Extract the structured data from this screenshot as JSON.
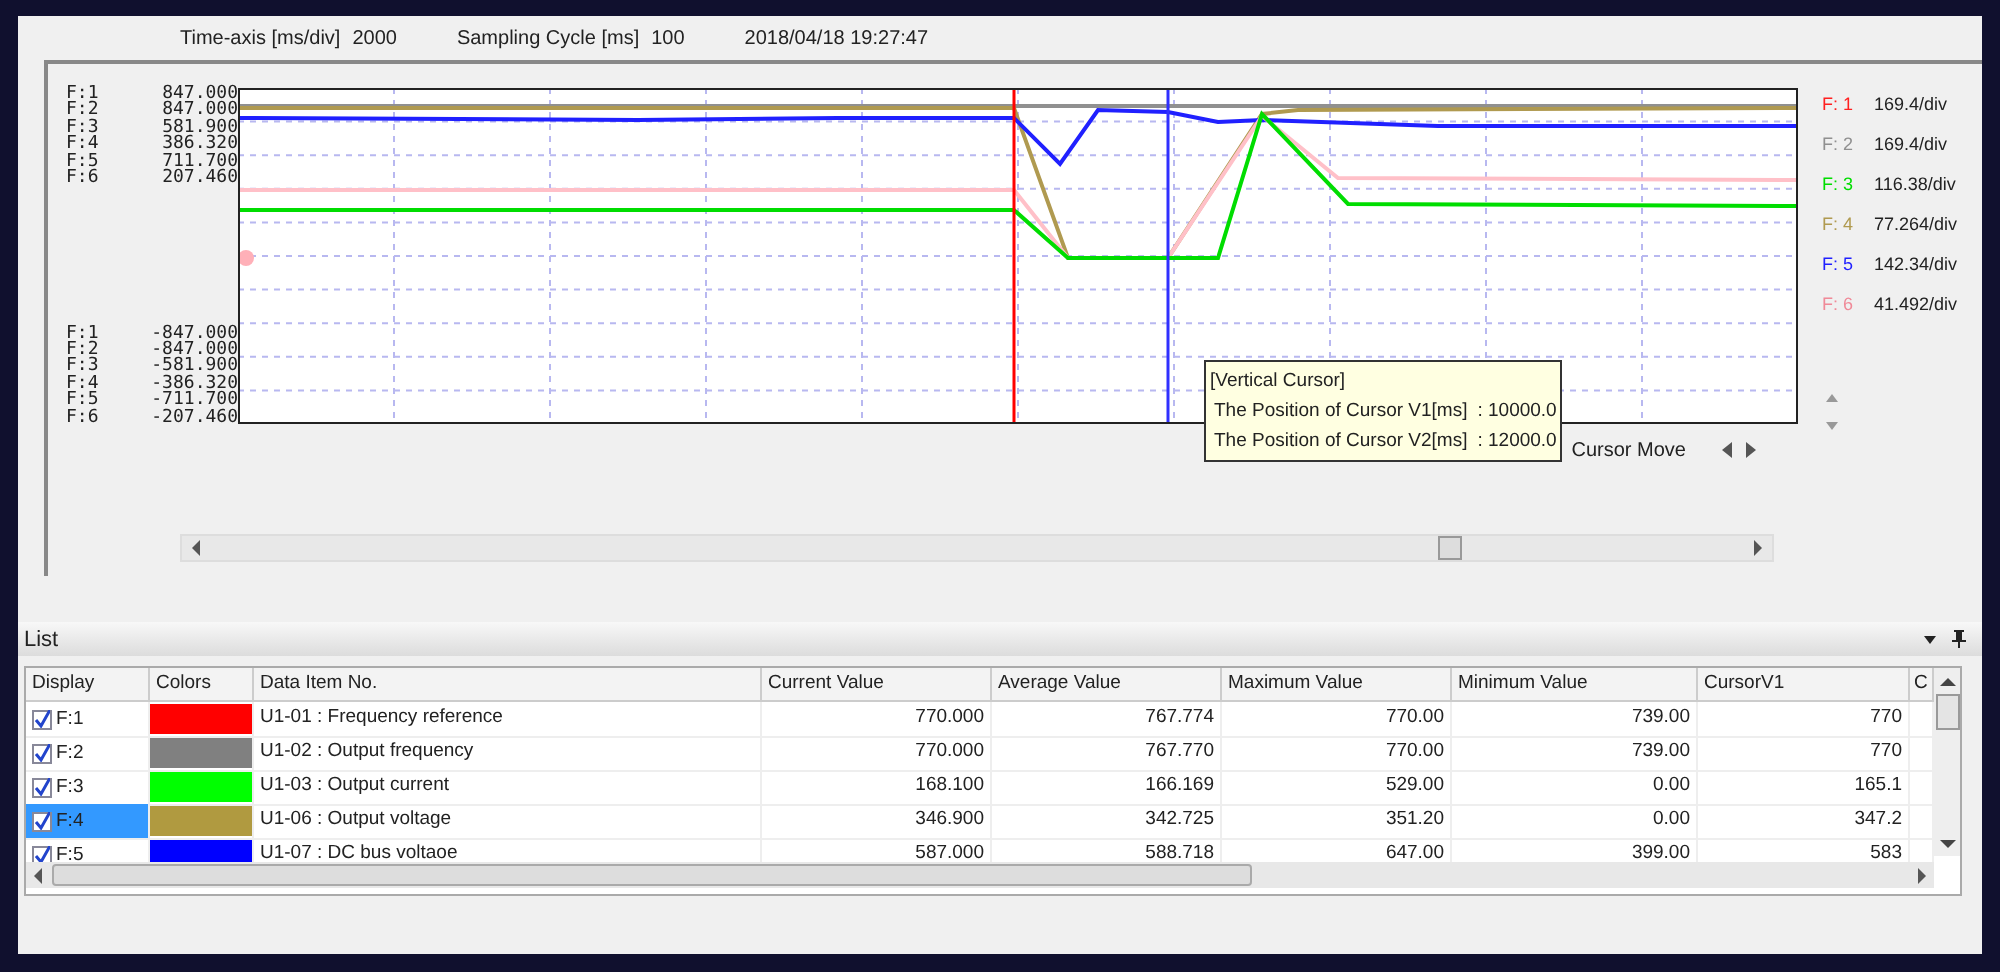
{
  "header": {
    "time_axis_label": "Time-axis [ms/div]",
    "time_axis_value": "2000",
    "sampling_label": "Sampling Cycle [ms]",
    "sampling_value": "100",
    "timestamp": "2018/04/18 19:27:47"
  },
  "scale_top": [
    {
      "channel": "F:1",
      "value": "847.000"
    },
    {
      "channel": "F:2",
      "value": "847.000"
    },
    {
      "channel": "F:3",
      "value": "581.900"
    },
    {
      "channel": "F:4",
      "value": "386.320"
    },
    {
      "channel": "F:5",
      "value": "711.700"
    },
    {
      "channel": "F:6",
      "value": "207.460"
    }
  ],
  "scale_bottom": [
    {
      "channel": "F:1",
      "value": "-847.000"
    },
    {
      "channel": "F:2",
      "value": "-847.000"
    },
    {
      "channel": "F:3",
      "value": "-581.900"
    },
    {
      "channel": "F:4",
      "value": "-386.320"
    },
    {
      "channel": "F:5",
      "value": "-711.700"
    },
    {
      "channel": "F:6",
      "value": "-207.460"
    }
  ],
  "legend": [
    {
      "channel": "F: 1",
      "scale": "169.4/div",
      "color": "#ff2020"
    },
    {
      "channel": "F: 2",
      "scale": "169.4/div",
      "color": "#909090"
    },
    {
      "channel": "F: 3",
      "scale": "116.38/div",
      "color": "#00dd00"
    },
    {
      "channel": "F: 4",
      "scale": "77.264/div",
      "color": "#b09a50"
    },
    {
      "channel": "F: 5",
      "scale": "142.34/div",
      "color": "#2020ff"
    },
    {
      "channel": "F: 6",
      "scale": "41.492/div",
      "color": "#f08a98"
    }
  ],
  "tooltip": {
    "title": "[Vertical Cursor]",
    "rows": [
      {
        "label": "The Position of Cursor V1[ms]",
        "value": ": 10000.0"
      },
      {
        "label": "The Position of Cursor V2[ms]",
        "value": ": 12000.0"
      }
    ]
  },
  "cursor_move": {
    "label": "Cursor Move"
  },
  "list": {
    "title": "List",
    "columns": [
      "Display",
      "Colors",
      "Data Item No.",
      "Current Value",
      "Average Value",
      "Maximum Value",
      "Minimum Value",
      "CursorV1",
      "C"
    ],
    "rows": [
      {
        "display": "F:1",
        "checked": true,
        "selected": false,
        "color": "#ff0000",
        "item": "U1-01 : Frequency reference",
        "current": "770.000",
        "average": "767.774",
        "maximum": "770.00",
        "minimum": "739.00",
        "cursor_v1": "770"
      },
      {
        "display": "F:2",
        "checked": true,
        "selected": false,
        "color": "#808080",
        "item": "U1-02 : Output frequency",
        "current": "770.000",
        "average": "767.770",
        "maximum": "770.00",
        "minimum": "739.00",
        "cursor_v1": "770"
      },
      {
        "display": "F:3",
        "checked": true,
        "selected": false,
        "color": "#00ff00",
        "item": "U1-03 : Output current",
        "current": "168.100",
        "average": "166.169",
        "maximum": "529.00",
        "minimum": "0.00",
        "cursor_v1": "165.1"
      },
      {
        "display": "F:4",
        "checked": true,
        "selected": true,
        "color": "#b09a40",
        "item": "U1-06 : Output voltage",
        "current": "346.900",
        "average": "342.725",
        "maximum": "351.20",
        "minimum": "0.00",
        "cursor_v1": "347.2"
      },
      {
        "display": "F:5",
        "checked": true,
        "selected": false,
        "color": "#0000ff",
        "item": "U1-07 : DC bus voltaoe",
        "current": "587.000",
        "average": "588.718",
        "maximum": "647.00",
        "minimum": "399.00",
        "cursor_v1": "583"
      }
    ]
  }
}
